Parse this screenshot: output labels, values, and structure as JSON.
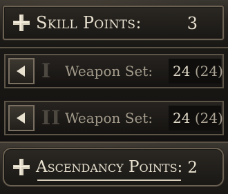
{
  "skill_points": {
    "label": "Skill Points:",
    "value": "3",
    "icon": "plus-icon"
  },
  "weapon_sets": [
    {
      "numeral": "I",
      "label": "Weapon Set:",
      "value": "24",
      "max": "(24)",
      "icon": "left-arrow-icon"
    },
    {
      "numeral": "II",
      "label": "Weapon Set:",
      "value": "24",
      "max": "(24)",
      "icon": "left-arrow-icon"
    }
  ],
  "ascendancy_points": {
    "label": "Ascendancy Points:",
    "value": "2",
    "icon": "plus-icon"
  },
  "colors": {
    "text": "#e8e1d0",
    "muted_text": "#a29a8a",
    "frame": "#6a6152",
    "background": "#0d0c0a"
  }
}
